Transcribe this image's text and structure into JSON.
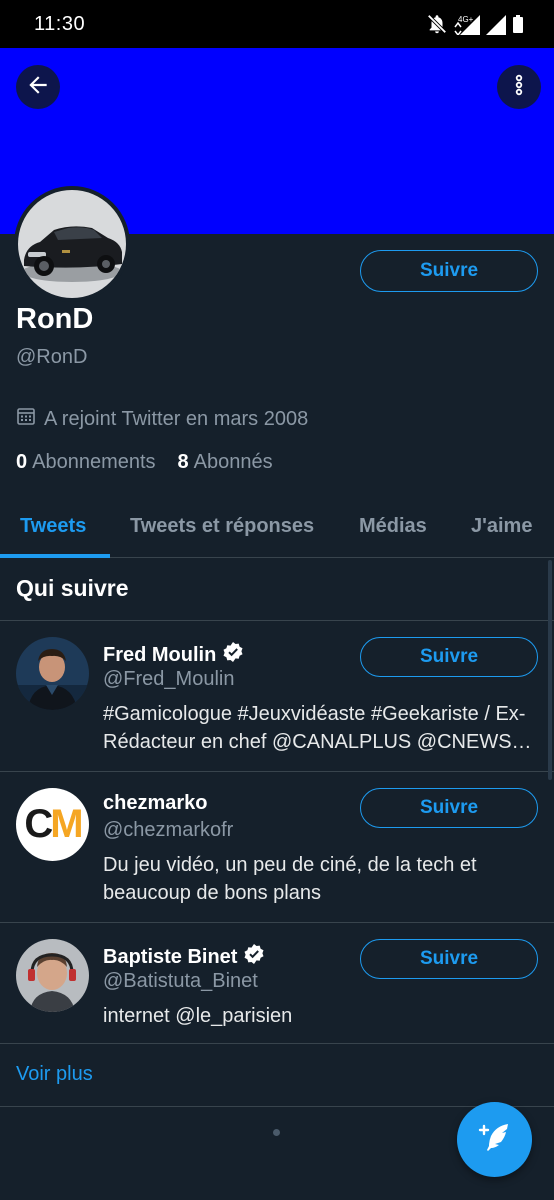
{
  "status_bar": {
    "time": "11:30",
    "icons": [
      "bell-off-icon",
      "data-4g-icon",
      "signal-icon",
      "signal-icon",
      "battery-icon"
    ]
  },
  "header": {
    "banner_color": "#0000ff",
    "back_icon": "arrow-left-icon",
    "more_icon": "more-vertical-icon"
  },
  "profile": {
    "name": "RonD",
    "handle": "@RonD",
    "joined": "A rejoint Twitter en mars 2008",
    "joined_icon": "calendar-icon",
    "following_count": "0",
    "following_label": "Abonnements",
    "followers_count": "8",
    "followers_label": "Abonnés",
    "follow_label": "Suivre"
  },
  "tabs": [
    {
      "label": "Tweets",
      "active": true
    },
    {
      "label": "Tweets et réponses",
      "active": false
    },
    {
      "label": "Médias",
      "active": false
    },
    {
      "label": "J'aime",
      "active": false
    }
  ],
  "who_to_follow": {
    "title": "Qui suivre",
    "suggestions": [
      {
        "name": "Fred Moulin",
        "verified": true,
        "handle": "@Fred_Moulin",
        "bio": "#Gamicologue #Jeuxvidéaste #Geekariste / Ex-Rédacteur en chef @CANALPLUS @CNEWS et",
        "follow_label": "Suivre"
      },
      {
        "name": "chezmarko",
        "verified": false,
        "handle": "@chezmarkofr",
        "bio": "Du jeu vidéo, un peu de ciné, de la tech et beaucoup de bons plans",
        "follow_label": "Suivre",
        "logo_text_c": "C",
        "logo_text_m": "M"
      },
      {
        "name": "Baptiste Binet",
        "verified": true,
        "handle": "@Batistuta_Binet",
        "bio": "internet @le_parisien",
        "follow_label": "Suivre"
      }
    ],
    "more_label": "Voir plus"
  },
  "colors": {
    "background": "#15202b",
    "accent": "#1d9bf0",
    "muted_text": "#8b98a5"
  },
  "fab": {
    "icon": "compose-tweet-icon"
  }
}
